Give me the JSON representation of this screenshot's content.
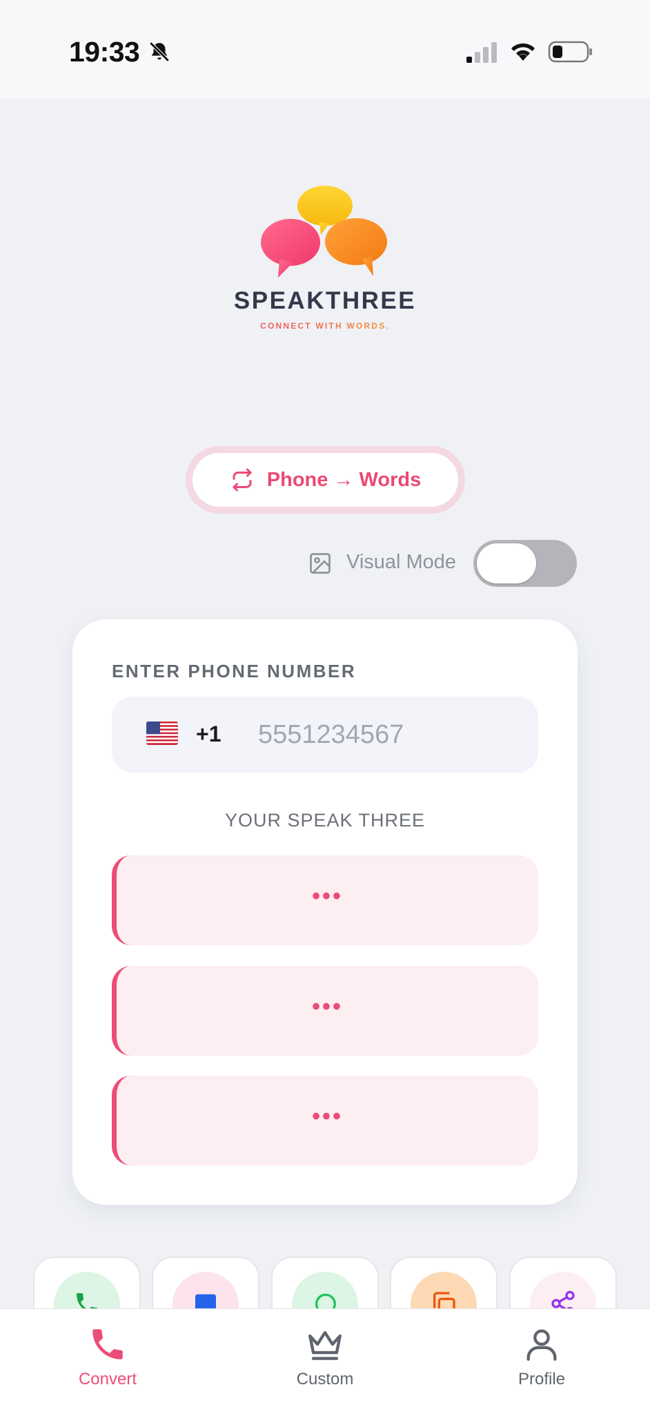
{
  "status_bar": {
    "time": "19:33",
    "icons": [
      "bell-slash-icon",
      "cellular-signal-icon",
      "wifi-icon",
      "battery-icon"
    ]
  },
  "brand": {
    "name": "SPEAKTHREE",
    "tagline": "CONNECT WITH WORDS."
  },
  "mode_toggle": {
    "label": "Phone → Words",
    "icon": "swap-arrows-icon",
    "color": "#ea4a74"
  },
  "visual_mode": {
    "label": "Visual Mode",
    "icon": "image-icon",
    "enabled": false
  },
  "converter": {
    "input_label": "ENTER PHONE NUMBER",
    "country_flag": "us-flag-icon",
    "dial_code": "+1",
    "phone_placeholder": "5551234567",
    "phone_value": "",
    "result_label": "YOUR SPEAK THREE",
    "results": [
      "•••",
      "•••",
      "•••"
    ]
  },
  "share_actions": [
    {
      "icon": "phone-icon",
      "color": "#1aa34a",
      "bg": "#ddf5e4"
    },
    {
      "icon": "message-icon",
      "color": "#2563eb",
      "bg": "#fde3ec"
    },
    {
      "icon": "whatsapp-icon",
      "color": "#22c55e",
      "bg": "#ddf5e4"
    },
    {
      "icon": "copy-icon",
      "color": "#ea580c",
      "bg": "#fdd9b5"
    },
    {
      "icon": "share-icon",
      "color": "#9333ea",
      "bg": "#fdeef2"
    }
  ],
  "tab_bar": {
    "tabs": [
      {
        "label": "Convert",
        "icon": "phone-icon",
        "active": true
      },
      {
        "label": "Custom",
        "icon": "crown-icon",
        "active": false
      },
      {
        "label": "Profile",
        "icon": "user-icon",
        "active": false
      }
    ],
    "active_color": "#ec4d78",
    "inactive_color": "#5f646d"
  }
}
